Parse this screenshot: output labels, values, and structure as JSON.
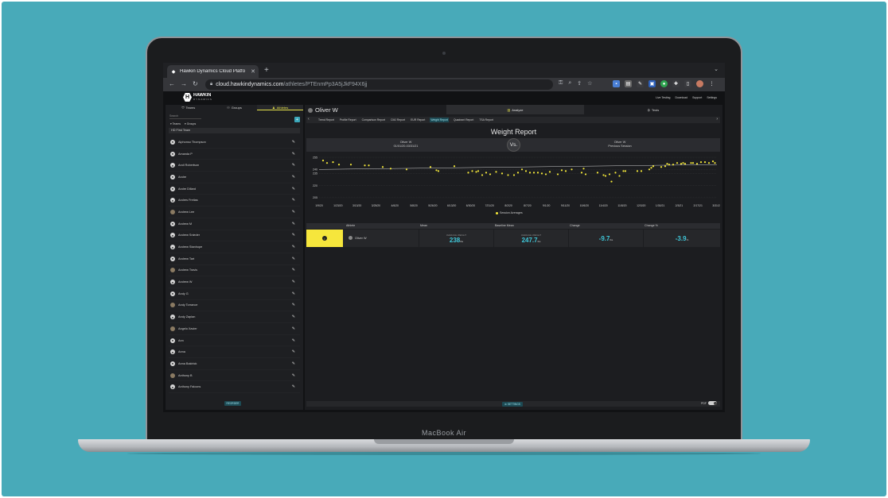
{
  "browser": {
    "tab_title": "Hawkin Dynamics Cloud Platfo",
    "url_host": "cloud.hawkindynamics.com",
    "url_path": "/athletes/PTEnmPp3A5jJkF94X6jj"
  },
  "app": {
    "logo_word": "HAWKIN",
    "logo_sub": "DYNAMICS",
    "header_links": [
      "Live Testing",
      "Download",
      "Support",
      "Settings"
    ]
  },
  "left": {
    "tabs": [
      "Teams",
      "Groups",
      "Athletes"
    ],
    "search_placeholder": "Search",
    "filters": [
      "Teams",
      "Groups"
    ],
    "team": "HD First Team",
    "athletes": [
      "Alphonso Thompson",
      "Amanda P",
      "Andi Robertson",
      "Andre",
      "Andre Dillard",
      "Andres Freitas",
      "Andrew Lee",
      "Andrew M",
      "Andrew Snieder",
      "Andrew Stanhope",
      "Andrew Tart",
      "Andrew Travis",
      "Andrew W",
      "Andy G",
      "Andy Torrance",
      "Andy Zaplan",
      "Angelo Xavier",
      "Ann",
      "Anna",
      "Anna Baldrick",
      "Anthony B",
      "Anthony Falcons"
    ],
    "reorder_label": "REORDER"
  },
  "right": {
    "athlete_name": "Oliver W",
    "tab_analyze": "Analyze",
    "tab_tests": "Tests",
    "reports": [
      "Trend Report",
      "Profile Report",
      "Comparison Report",
      "CMJ Report",
      "EUR Report",
      "Weight Report",
      "Quadrant Report",
      "TSA Report"
    ],
    "active_report": "Weight Report",
    "title": "Weight Report",
    "vs_left_name": "Oliver W",
    "vs_left_range": "01/01/20-03/31/21",
    "vs_label": "Vs.",
    "vs_right_name": "Oliver W",
    "vs_right_sub": "Previous Session",
    "legend": "Session Averages",
    "stats_headers": [
      "Athlete",
      "Mean",
      "Baseline Mean",
      "Change",
      "Change %"
    ],
    "stats": {
      "athlete": "Oliver W",
      "mean_caption": "AVERAGE WEIGHT",
      "mean": "238",
      "baseline_caption": "AVERAGE WEIGHT",
      "baseline": "247.7",
      "unit": "lbs",
      "change": "-9.7",
      "change_pct": "-3.9",
      "pct_unit": "%"
    },
    "settings_label": "SETTINGS",
    "pdf_label": "PDF"
  },
  "chart_data": {
    "type": "scatter",
    "title": "Weight Report",
    "xlabel": "",
    "ylabel": "",
    "yticks": [
      205,
      220,
      235,
      240,
      255
    ],
    "ylim": [
      200,
      258
    ],
    "xticks": [
      "1/9/20",
      "1/23/20",
      "3/13/20",
      "3/25/20",
      "4/6/20",
      "5/8/20",
      "5/26/20",
      "6/13/20",
      "6/30/20",
      "7/21/20",
      "8/2/20",
      "8/7/20",
      "9/1/20",
      "9/11/20",
      "10/6/20",
      "11/4/20",
      "11/8/20",
      "12/3/20",
      "1/30/21",
      "2/3/21",
      "2/17/21",
      "3/31/21"
    ],
    "series": [
      {
        "name": "Session Averages",
        "color": "#f5e93a",
        "points": [
          [
            0.01,
            251
          ],
          [
            0.02,
            248
          ],
          [
            0.035,
            249
          ],
          [
            0.05,
            246
          ],
          [
            0.08,
            246
          ],
          [
            0.115,
            245
          ],
          [
            0.125,
            245
          ],
          [
            0.16,
            243
          ],
          [
            0.18,
            241
          ],
          [
            0.22,
            240
          ],
          [
            0.28,
            243
          ],
          [
            0.295,
            239
          ],
          [
            0.3,
            238
          ],
          [
            0.34,
            244
          ],
          [
            0.375,
            236
          ],
          [
            0.385,
            238
          ],
          [
            0.395,
            237
          ],
          [
            0.4,
            238
          ],
          [
            0.41,
            233
          ],
          [
            0.42,
            236
          ],
          [
            0.43,
            234
          ],
          [
            0.445,
            237
          ],
          [
            0.46,
            235
          ],
          [
            0.475,
            233
          ],
          [
            0.49,
            233
          ],
          [
            0.5,
            236
          ],
          [
            0.51,
            240
          ],
          [
            0.52,
            238
          ],
          [
            0.53,
            236
          ],
          [
            0.54,
            236
          ],
          [
            0.55,
            236
          ],
          [
            0.56,
            235
          ],
          [
            0.57,
            234
          ],
          [
            0.58,
            237
          ],
          [
            0.6,
            234
          ],
          [
            0.61,
            239
          ],
          [
            0.62,
            238
          ],
          [
            0.635,
            240
          ],
          [
            0.66,
            236
          ],
          [
            0.67,
            234
          ],
          [
            0.665,
            241
          ],
          [
            0.7,
            236
          ],
          [
            0.715,
            233
          ],
          [
            0.72,
            232
          ],
          [
            0.73,
            234
          ],
          [
            0.735,
            225
          ],
          [
            0.745,
            236
          ],
          [
            0.755,
            232
          ],
          [
            0.765,
            238
          ],
          [
            0.77,
            238
          ],
          [
            0.8,
            238
          ],
          [
            0.81,
            238
          ],
          [
            0.83,
            240
          ],
          [
            0.835,
            242
          ],
          [
            0.84,
            244
          ],
          [
            0.86,
            243
          ],
          [
            0.87,
            244
          ],
          [
            0.875,
            247
          ],
          [
            0.88,
            246
          ],
          [
            0.89,
            246
          ],
          [
            0.9,
            248
          ],
          [
            0.91,
            247
          ],
          [
            0.915,
            248
          ],
          [
            0.92,
            247
          ],
          [
            0.935,
            248
          ],
          [
            0.94,
            248
          ],
          [
            0.95,
            247
          ],
          [
            0.96,
            249
          ],
          [
            0.97,
            249
          ],
          [
            0.98,
            248
          ],
          [
            0.99,
            250
          ],
          [
            0.995,
            248
          ]
        ]
      }
    ],
    "trend_line": [
      [
        0,
        240
      ],
      [
        1,
        246
      ]
    ],
    "grid": true,
    "legend_position": "bottom-center"
  }
}
